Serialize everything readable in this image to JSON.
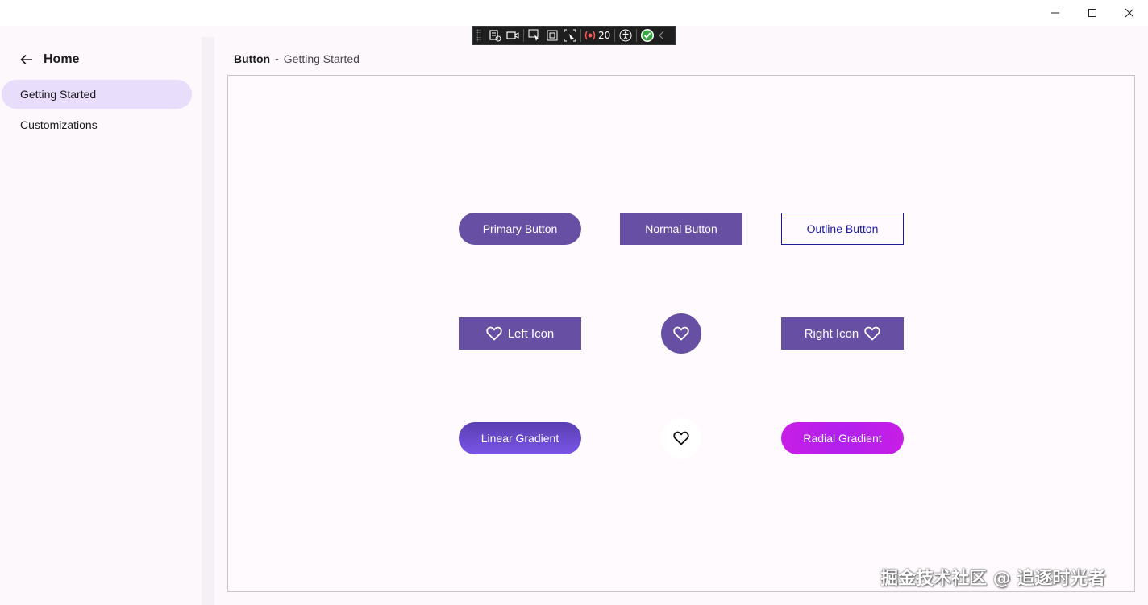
{
  "window": {
    "minimize_icon": "minimize-icon",
    "maximize_icon": "maximize-icon",
    "close_icon": "close-icon"
  },
  "debug_toolbar": {
    "binding_failures_count": "20"
  },
  "sidebar": {
    "home_label": "Home",
    "items": [
      {
        "label": "Getting Started",
        "active": true
      },
      {
        "label": "Customizations",
        "active": false
      }
    ]
  },
  "breadcrumb": {
    "section": "Button",
    "separator": "-",
    "current": "Getting Started"
  },
  "buttons": {
    "primary": "Primary Button",
    "normal": "Normal Button",
    "outline": "Outline Button",
    "left_icon": "Left Icon",
    "right_icon": "Right Icon",
    "linear_gradient": "Linear Gradient",
    "radial_gradient": "Radial Gradient"
  },
  "colors": {
    "primary": "#6750a4",
    "outline": "#1a1aa0",
    "active_nav": "#e8ddfb",
    "radial": "#c81ee6"
  },
  "watermark": "掘金技术社区 @ 追逐时光者"
}
